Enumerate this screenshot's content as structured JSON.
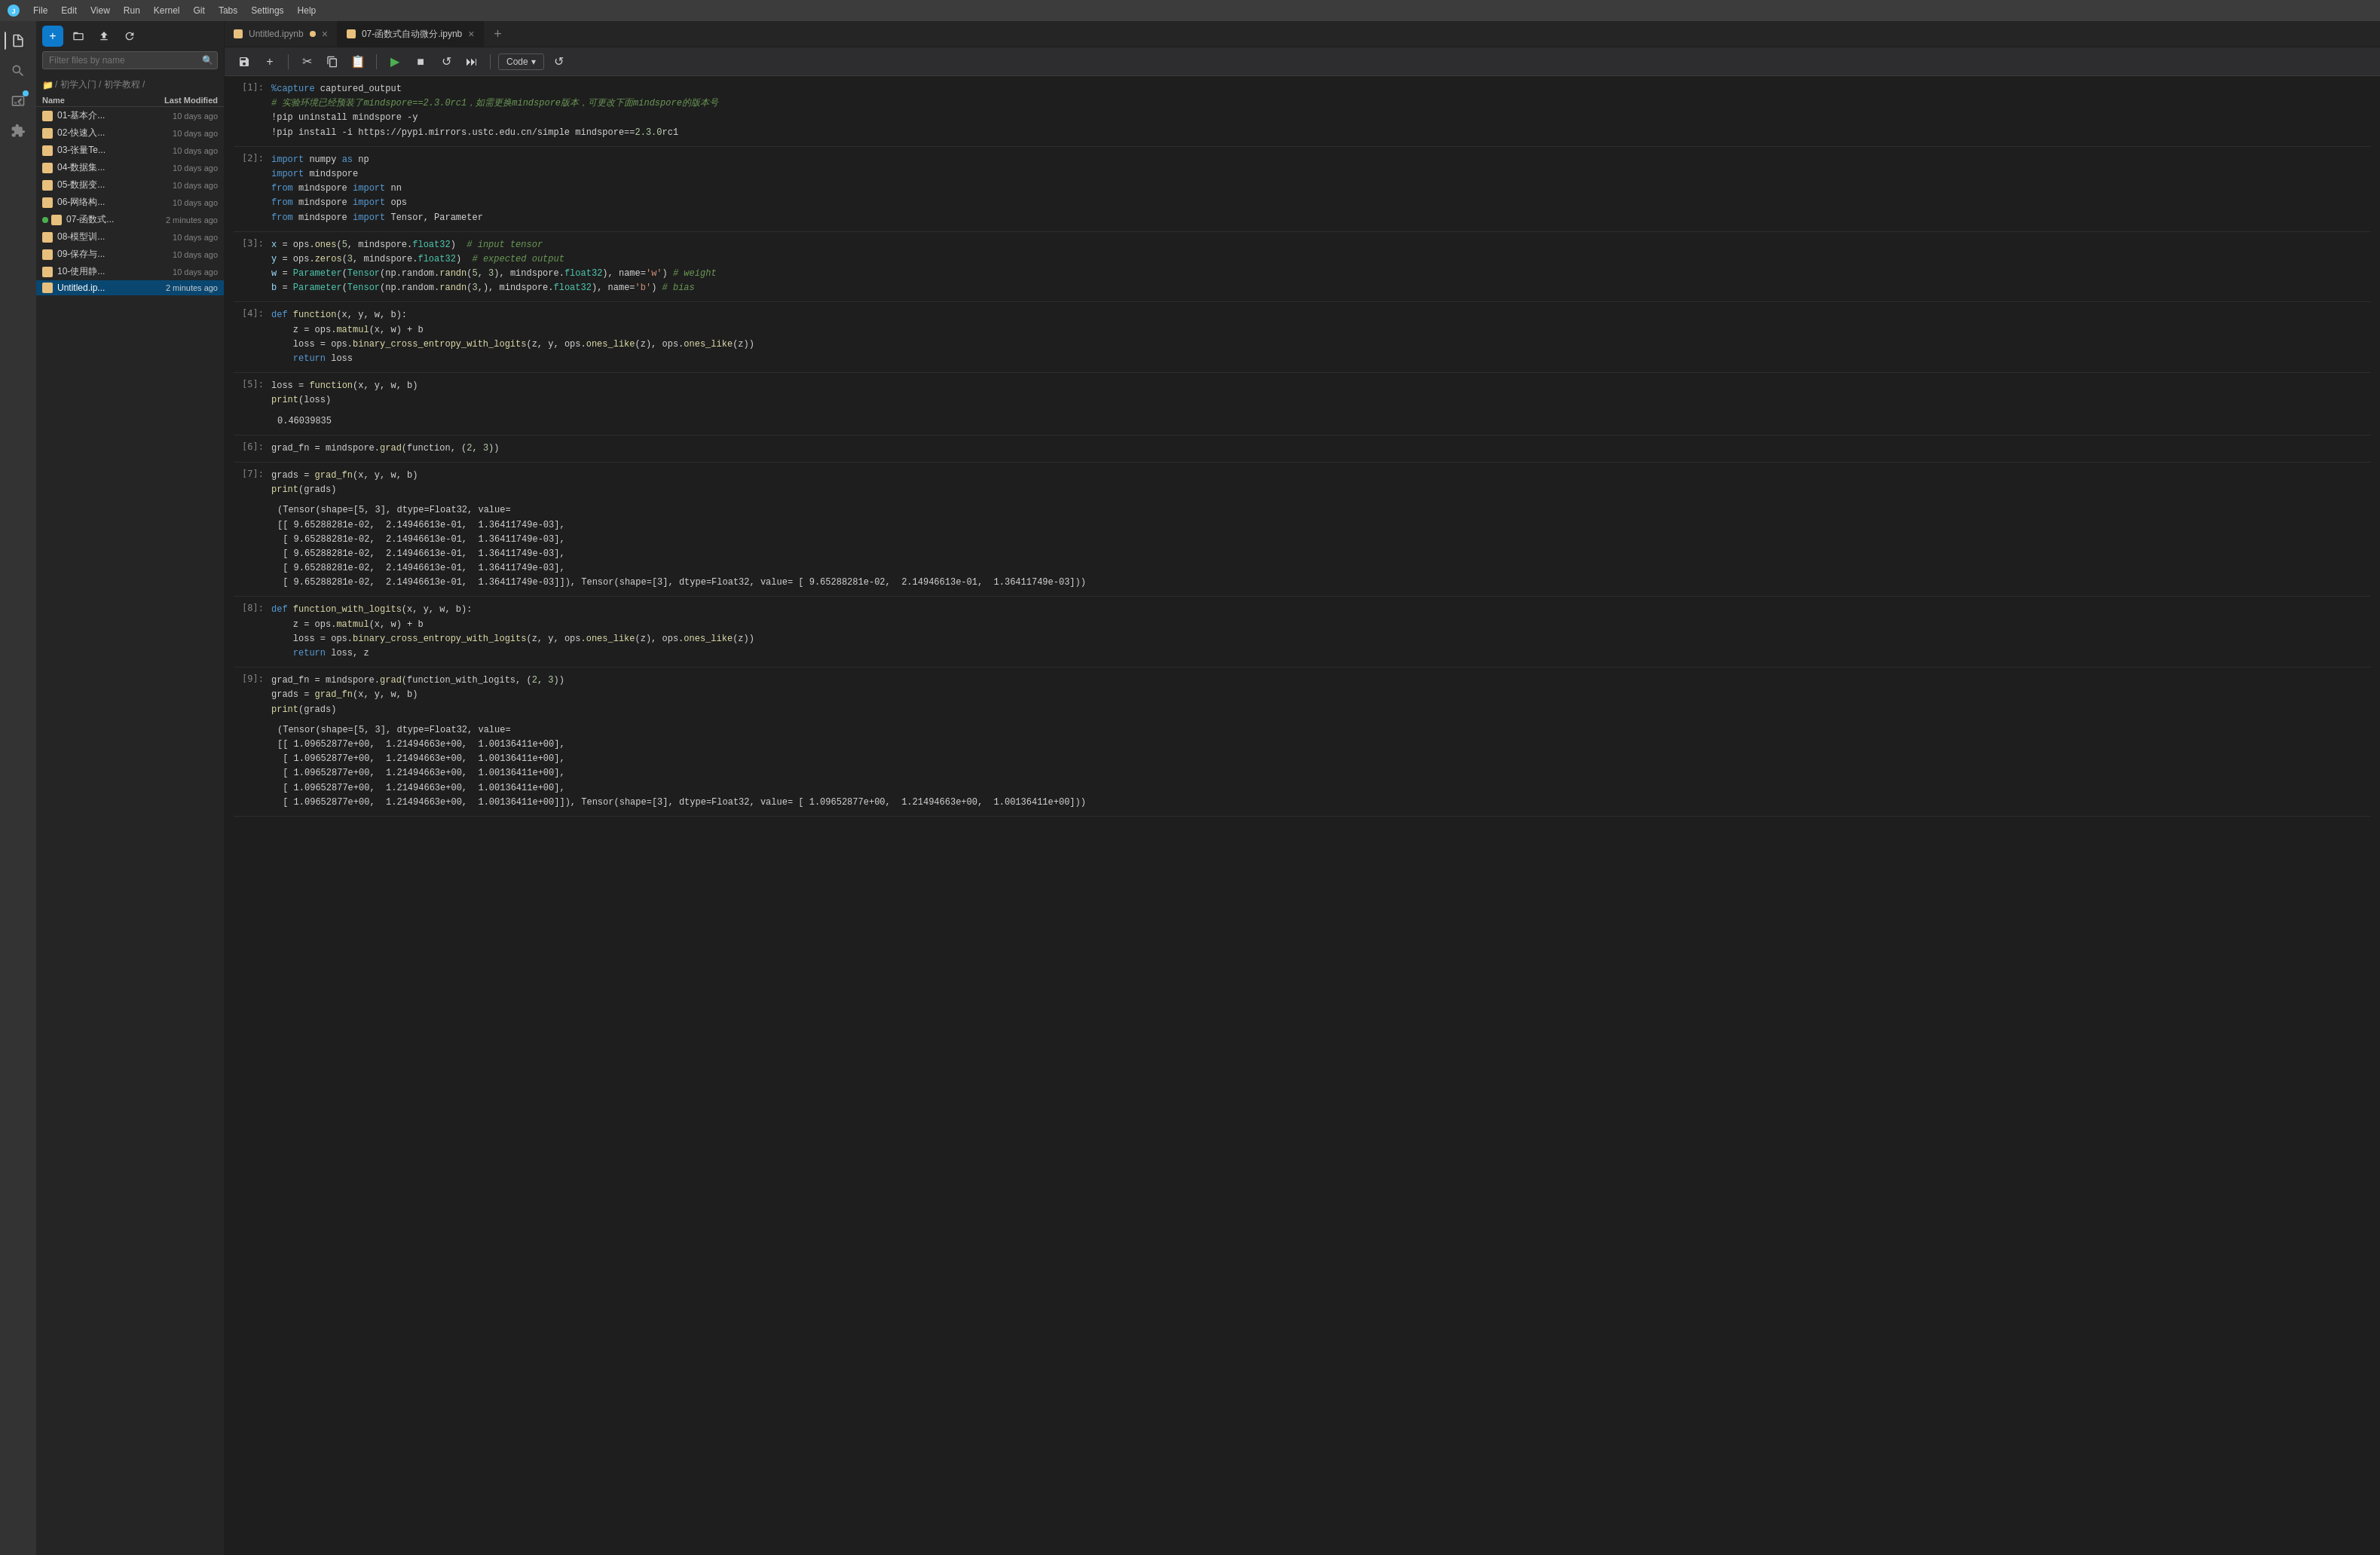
{
  "menubar": {
    "items": [
      "File",
      "Edit",
      "View",
      "Run",
      "Kernel",
      "Git",
      "Tabs",
      "Settings",
      "Help"
    ]
  },
  "sidebar": {
    "search_placeholder": "Filter files by name",
    "breadcrumb": [
      "/ 初学入门 / 初学教程 /"
    ],
    "columns": {
      "name": "Name",
      "modified": "Last Modified"
    },
    "files": [
      {
        "id": "01",
        "name": "01-基本介...",
        "modified": "10 days ago",
        "active": false,
        "dot": false
      },
      {
        "id": "02",
        "name": "02-快速入...",
        "modified": "10 days ago",
        "active": false,
        "dot": false
      },
      {
        "id": "03",
        "name": "03-张量Te...",
        "modified": "10 days ago",
        "active": false,
        "dot": false
      },
      {
        "id": "04",
        "name": "04-数据集...",
        "modified": "10 days ago",
        "active": false,
        "dot": false
      },
      {
        "id": "05",
        "name": "05-数据变...",
        "modified": "10 days ago",
        "active": false,
        "dot": false
      },
      {
        "id": "06",
        "name": "06-网络构...",
        "modified": "10 days ago",
        "active": false,
        "dot": false
      },
      {
        "id": "07",
        "name": "07-函数式...",
        "modified": "2 minutes ago",
        "active": false,
        "dot": true
      },
      {
        "id": "08",
        "name": "08-模型训...",
        "modified": "10 days ago",
        "active": false,
        "dot": false
      },
      {
        "id": "09",
        "name": "09-保存与...",
        "modified": "10 days ago",
        "active": false,
        "dot": false
      },
      {
        "id": "10",
        "name": "10-使用静...",
        "modified": "10 days ago",
        "active": false,
        "dot": false
      },
      {
        "id": "Untitled",
        "name": "Untitled.ip...",
        "modified": "2 minutes ago",
        "active": true,
        "dot": false
      }
    ]
  },
  "tabs": [
    {
      "id": "untitled",
      "label": "Untitled.ipynb",
      "active": false,
      "unsaved": true
    },
    {
      "id": "07",
      "label": "07-函数式自动微分.ipynb",
      "active": true,
      "unsaved": false
    }
  ],
  "toolbar": {
    "kernel": "Code",
    "buttons": [
      "save",
      "add",
      "cut",
      "copy",
      "paste",
      "run",
      "stop",
      "restart",
      "ff",
      "code-select",
      "restart2"
    ]
  },
  "cells": [
    {
      "number": "[1]:",
      "type": "code",
      "lines": [
        {
          "tokens": [
            {
              "t": "magic",
              "v": "%capture"
            },
            {
              "t": "op",
              "v": " captured_output"
            }
          ]
        },
        {
          "tokens": [
            {
              "t": "cmt",
              "v": "# 实验环境已经预装了mindspore==2.3.0rc1，如需更换mindspore版本，可更改下面mindspore的版本号"
            }
          ]
        },
        {
          "tokens": [
            {
              "t": "op",
              "v": "!pip uninstall mindspore "
            },
            {
              "t": "op",
              "v": "-y"
            }
          ]
        },
        {
          "tokens": [
            {
              "t": "op",
              "v": "!pip install -i https://pypi.mirrors.ustc.edu.cn/simple mindspore=="
            },
            {
              "t": "num",
              "v": "2.3.0"
            },
            {
              "t": "op",
              "v": "rc1"
            }
          ]
        }
      ]
    },
    {
      "number": "[2]:",
      "type": "code",
      "lines": [
        {
          "tokens": [
            {
              "t": "kw",
              "v": "import"
            },
            {
              "t": "op",
              "v": " numpy "
            },
            {
              "t": "kw",
              "v": "as"
            },
            {
              "t": "op",
              "v": " np"
            }
          ]
        },
        {
          "tokens": [
            {
              "t": "kw",
              "v": "import"
            },
            {
              "t": "op",
              "v": " mindspore"
            }
          ]
        },
        {
          "tokens": [
            {
              "t": "kw",
              "v": "from"
            },
            {
              "t": "op",
              "v": " mindspore "
            },
            {
              "t": "kw",
              "v": "import"
            },
            {
              "t": "op",
              "v": " nn"
            }
          ]
        },
        {
          "tokens": [
            {
              "t": "kw",
              "v": "from"
            },
            {
              "t": "op",
              "v": " mindspore "
            },
            {
              "t": "kw",
              "v": "import"
            },
            {
              "t": "op",
              "v": " ops"
            }
          ]
        },
        {
          "tokens": [
            {
              "t": "kw",
              "v": "from"
            },
            {
              "t": "op",
              "v": " mindspore "
            },
            {
              "t": "kw",
              "v": "import"
            },
            {
              "t": "op",
              "v": " Tensor, Parameter"
            }
          ]
        }
      ]
    },
    {
      "number": "[3]:",
      "type": "code",
      "lines": [
        {
          "tokens": [
            {
              "t": "var",
              "v": "x"
            },
            {
              "t": "op",
              "v": " = ops."
            },
            {
              "t": "fn",
              "v": "ones"
            },
            {
              "t": "op",
              "v": "("
            },
            {
              "t": "num",
              "v": "5"
            },
            {
              "t": "op",
              "v": ", mindspore."
            },
            {
              "t": "cls",
              "v": "float32"
            },
            {
              "t": "op",
              "v": ")  "
            },
            {
              "t": "cmt",
              "v": "# input tensor"
            }
          ]
        },
        {
          "tokens": [
            {
              "t": "var",
              "v": "y"
            },
            {
              "t": "op",
              "v": " = ops."
            },
            {
              "t": "fn",
              "v": "zeros"
            },
            {
              "t": "op",
              "v": "("
            },
            {
              "t": "num",
              "v": "3"
            },
            {
              "t": "op",
              "v": ", mindspore."
            },
            {
              "t": "cls",
              "v": "float32"
            },
            {
              "t": "op",
              "v": ")  "
            },
            {
              "t": "cmt",
              "v": "# expected output"
            }
          ]
        },
        {
          "tokens": [
            {
              "t": "var",
              "v": "w"
            },
            {
              "t": "op",
              "v": " = "
            },
            {
              "t": "cls",
              "v": "Parameter"
            },
            {
              "t": "op",
              "v": "("
            },
            {
              "t": "cls",
              "v": "Tensor"
            },
            {
              "t": "op",
              "v": "(np.random."
            },
            {
              "t": "fn",
              "v": "randn"
            },
            {
              "t": "op",
              "v": "("
            },
            {
              "t": "num",
              "v": "5"
            },
            {
              "t": "op",
              "v": ", "
            },
            {
              "t": "num",
              "v": "3"
            },
            {
              "t": "op",
              "v": "), mindspore."
            },
            {
              "t": "cls",
              "v": "float32"
            },
            {
              "t": "op",
              "v": "), name="
            },
            {
              "t": "str",
              "v": "'w'"
            },
            {
              "t": "op",
              "v": ") "
            },
            {
              "t": "cmt",
              "v": "# weight"
            }
          ]
        },
        {
          "tokens": [
            {
              "t": "var",
              "v": "b"
            },
            {
              "t": "op",
              "v": " = "
            },
            {
              "t": "cls",
              "v": "Parameter"
            },
            {
              "t": "op",
              "v": "("
            },
            {
              "t": "cls",
              "v": "Tensor"
            },
            {
              "t": "op",
              "v": "(np.random."
            },
            {
              "t": "fn",
              "v": "randn"
            },
            {
              "t": "op",
              "v": "("
            },
            {
              "t": "num",
              "v": "3"
            },
            {
              "t": "op",
              "v": ",), mindspore."
            },
            {
              "t": "cls",
              "v": "float32"
            },
            {
              "t": "op",
              "v": "), name="
            },
            {
              "t": "str",
              "v": "'b'"
            },
            {
              "t": "op",
              "v": ") "
            },
            {
              "t": "cmt",
              "v": "# bias"
            }
          ]
        }
      ]
    },
    {
      "number": "[4]:",
      "type": "code",
      "lines": [
        {
          "tokens": [
            {
              "t": "kw",
              "v": "def"
            },
            {
              "t": "op",
              "v": " "
            },
            {
              "t": "fn",
              "v": "function"
            },
            {
              "t": "op",
              "v": "(x, y, w, b):"
            }
          ]
        },
        {
          "tokens": [
            {
              "t": "op",
              "v": "    z = ops."
            },
            {
              "t": "fn",
              "v": "matmul"
            },
            {
              "t": "op",
              "v": "(x, w) + b"
            }
          ]
        },
        {
          "tokens": [
            {
              "t": "op",
              "v": "    loss = ops."
            },
            {
              "t": "fn",
              "v": "binary_cross_entropy_with_logits"
            },
            {
              "t": "op",
              "v": "(z, y, ops."
            },
            {
              "t": "fn",
              "v": "ones_like"
            },
            {
              "t": "op",
              "v": "(z), ops."
            },
            {
              "t": "fn",
              "v": "ones_like"
            },
            {
              "t": "op",
              "v": "(z))"
            }
          ]
        },
        {
          "tokens": [
            {
              "t": "kw",
              "v": "    return"
            },
            {
              "t": "op",
              "v": " loss"
            }
          ]
        }
      ]
    },
    {
      "number": "[5]:",
      "type": "code",
      "output": "0.46039835",
      "lines": [
        {
          "tokens": [
            {
              "t": "op",
              "v": "loss = "
            },
            {
              "t": "fn",
              "v": "function"
            },
            {
              "t": "op",
              "v": "(x, y, w, b)"
            }
          ]
        },
        {
          "tokens": [
            {
              "t": "fn",
              "v": "print"
            },
            {
              "t": "op",
              "v": "(loss)"
            }
          ]
        }
      ]
    },
    {
      "number": "[6]:",
      "type": "code",
      "lines": [
        {
          "tokens": [
            {
              "t": "op",
              "v": "grad_fn = mindspore."
            },
            {
              "t": "fn",
              "v": "grad"
            },
            {
              "t": "op",
              "v": "(function, ("
            },
            {
              "t": "num",
              "v": "2"
            },
            {
              "t": "op",
              "v": ", "
            },
            {
              "t": "num",
              "v": "3"
            },
            {
              "t": "op",
              "v": "))"
            }
          ]
        }
      ]
    },
    {
      "number": "[7]:",
      "type": "code",
      "output": "(Tensor(shape=[5, 3], dtype=Float32, value=\n[[ 9.65288281e-02,  2.14946613e-01,  1.36411749e-03],\n [ 9.65288281e-02,  2.14946613e-01,  1.36411749e-03],\n [ 9.65288281e-02,  2.14946613e-01,  1.36411749e-03],\n [ 9.65288281e-02,  2.14946613e-01,  1.36411749e-03],\n [ 9.65288281e-02,  2.14946613e-01,  1.36411749e-03]]), Tensor(shape=[3], dtype=Float32, value= [ 9.65288281e-02,  2.14946613e-01,  1.36411749e-03]))",
      "lines": [
        {
          "tokens": [
            {
              "t": "op",
              "v": "grads = "
            },
            {
              "t": "fn",
              "v": "grad_fn"
            },
            {
              "t": "op",
              "v": "(x, y, w, b)"
            }
          ]
        },
        {
          "tokens": [
            {
              "t": "fn",
              "v": "print"
            },
            {
              "t": "op",
              "v": "(grads)"
            }
          ]
        }
      ]
    },
    {
      "number": "[8]:",
      "type": "code",
      "lines": [
        {
          "tokens": [
            {
              "t": "kw",
              "v": "def"
            },
            {
              "t": "op",
              "v": " "
            },
            {
              "t": "fn",
              "v": "function_with_logits"
            },
            {
              "t": "op",
              "v": "(x, y, w, b):"
            }
          ]
        },
        {
          "tokens": [
            {
              "t": "op",
              "v": "    z = ops."
            },
            {
              "t": "fn",
              "v": "matmul"
            },
            {
              "t": "op",
              "v": "(x, w) + b"
            }
          ]
        },
        {
          "tokens": [
            {
              "t": "op",
              "v": "    loss = ops."
            },
            {
              "t": "fn",
              "v": "binary_cross_entropy_with_logits"
            },
            {
              "t": "op",
              "v": "(z, y, ops."
            },
            {
              "t": "fn",
              "v": "ones_like"
            },
            {
              "t": "op",
              "v": "(z), ops."
            },
            {
              "t": "fn",
              "v": "ones_like"
            },
            {
              "t": "op",
              "v": "(z))"
            }
          ]
        },
        {
          "tokens": [
            {
              "t": "kw",
              "v": "    return"
            },
            {
              "t": "op",
              "v": " loss, z"
            }
          ]
        }
      ]
    },
    {
      "number": "[9]:",
      "type": "code",
      "output": "(Tensor(shape=[5, 3], dtype=Float32, value=\n[[ 1.09652877e+00,  1.21494663e+00,  1.00136411e+00],\n [ 1.09652877e+00,  1.21494663e+00,  1.00136411e+00],\n [ 1.09652877e+00,  1.21494663e+00,  1.00136411e+00],\n [ 1.09652877e+00,  1.21494663e+00,  1.00136411e+00],\n [ 1.09652877e+00,  1.21494663e+00,  1.00136411e+00]]), Tensor(shape=[3], dtype=Float32, value= [ 1.09652877e+00,  1.21494663e+00,  1.00136411e+00]))",
      "lines": [
        {
          "tokens": [
            {
              "t": "op",
              "v": "grad_fn = mindspore."
            },
            {
              "t": "fn",
              "v": "grad"
            },
            {
              "t": "op",
              "v": "(function_with_logits, ("
            },
            {
              "t": "num",
              "v": "2"
            },
            {
              "t": "op",
              "v": ", "
            },
            {
              "t": "num",
              "v": "3"
            },
            {
              "t": "op",
              "v": "))"
            }
          ]
        },
        {
          "tokens": [
            {
              "t": "op",
              "v": "grads = "
            },
            {
              "t": "fn",
              "v": "grad_fn"
            },
            {
              "t": "op",
              "v": "(x, y, w, b)"
            }
          ]
        },
        {
          "tokens": [
            {
              "t": "fn",
              "v": "print"
            },
            {
              "t": "op",
              "v": "(grads)"
            }
          ]
        }
      ]
    }
  ]
}
